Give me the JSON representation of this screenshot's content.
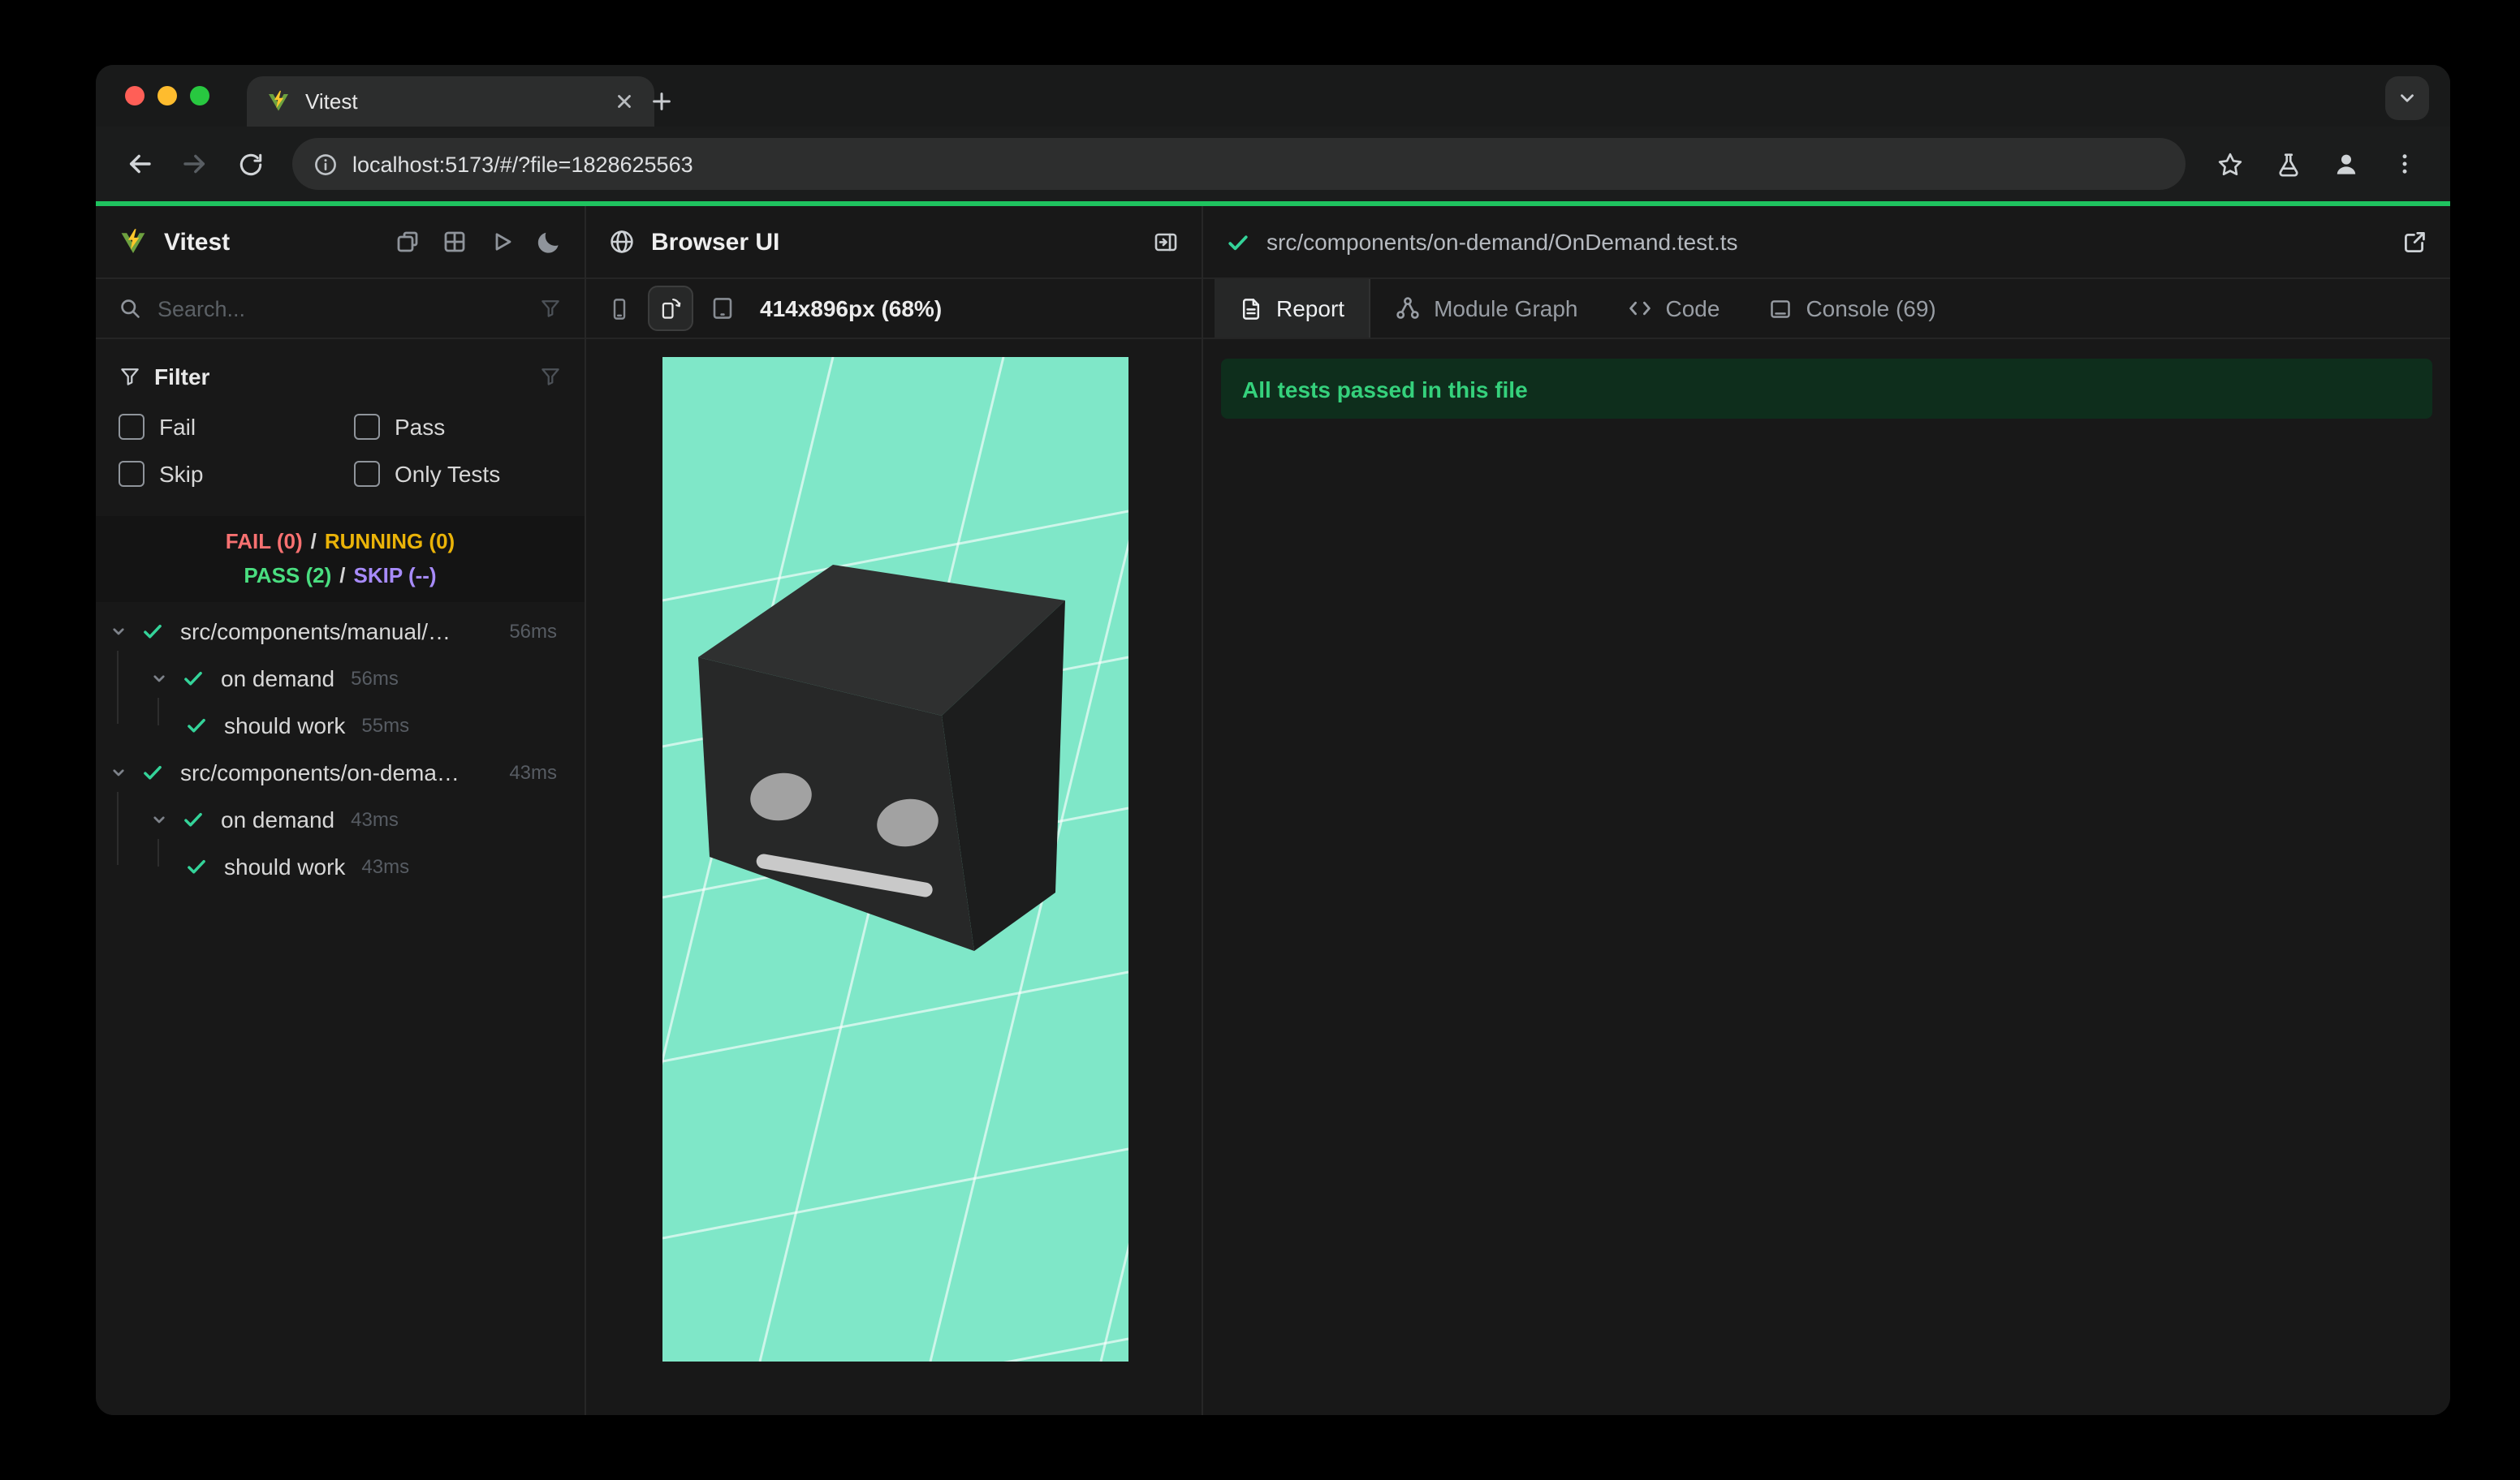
{
  "browser": {
    "tab_title": "Vitest",
    "url": "localhost:5173/#/?file=1828625563"
  },
  "sidebar": {
    "app_name": "Vitest",
    "search_placeholder": "Search...",
    "filter": {
      "title": "Filter",
      "fail": "Fail",
      "pass": "Pass",
      "skip": "Skip",
      "only_tests": "Only Tests"
    },
    "stats": {
      "fail": "FAIL (0)",
      "running": "RUNNING (0)",
      "pass": "PASS (2)",
      "skip": "SKIP (--)",
      "sep": "/"
    },
    "tree": [
      {
        "label": "src/components/manual/…",
        "time": "56ms"
      },
      {
        "label": "on demand",
        "time": "56ms"
      },
      {
        "label": "should work",
        "time": "55ms"
      },
      {
        "label": "src/components/on-dema…",
        "time": "43ms"
      },
      {
        "label": "on demand",
        "time": "43ms"
      },
      {
        "label": "should work",
        "time": "43ms"
      }
    ]
  },
  "preview": {
    "title": "Browser UI",
    "viewport_label": "414x896px (68%)"
  },
  "detail": {
    "file_path": "src/components/on-demand/OnDemand.test.ts",
    "tabs": [
      {
        "label": "Report"
      },
      {
        "label": "Module Graph"
      },
      {
        "label": "Code"
      },
      {
        "label": "Console (69)"
      }
    ],
    "banner": "All tests passed in this file"
  },
  "colors": {
    "accent_green": "#1fc35f",
    "mint_viewport": "#7fe7c8",
    "check_green": "#34d399",
    "fail_red": "#f87171",
    "running_yellow": "#eab308",
    "pass_green": "#4ade80",
    "skip_purple": "#a78bfa",
    "banner_bg": "#0e2e1c",
    "banner_text": "#35d17c",
    "traffic_red": "#ff5f57",
    "traffic_yellow": "#febc2e",
    "traffic_green": "#28c840"
  }
}
